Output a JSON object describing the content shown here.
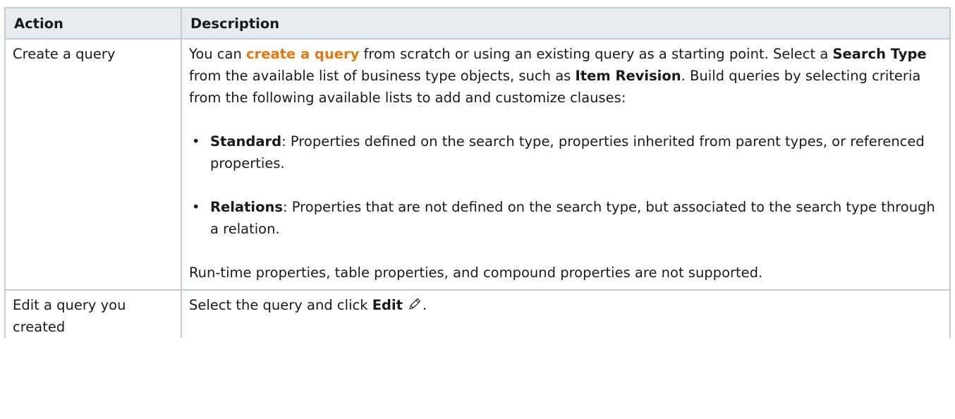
{
  "table": {
    "headers": {
      "action": "Action",
      "description": "Description"
    },
    "row1": {
      "action": "Create a query",
      "p1_before_link": "You can ",
      "p1_link": "create a query",
      "p1_after_link": " from scratch or using an existing query as a starting point. Select a ",
      "p1_bold_search_type": "Search Type",
      "p1_mid": " from the available list of business type objects, such as ",
      "p1_bold_item_revision": "Item Revision",
      "p1_end": ". Build queries by selecting criteria from the following available lists to add and customize clauses:",
      "bullets": [
        {
          "term": "Standard",
          "text": ": Properties defined on the search type, properties inherited from parent types, or referenced properties."
        },
        {
          "term": "Relations",
          "text": ": Properties that are not defined on the search type, but associated to the search type through a relation."
        }
      ],
      "note": "Run-time properties, table properties, and compound properties are not supported."
    },
    "row2": {
      "action": "Edit a query you created",
      "before_bold": "Select the query and click ",
      "bold_edit": "Edit",
      "icon": "pencil-icon",
      "end": "."
    }
  },
  "colors": {
    "link": "#e4770f",
    "header_bg": "#e6ecf0",
    "border": "#c3ccd3"
  }
}
